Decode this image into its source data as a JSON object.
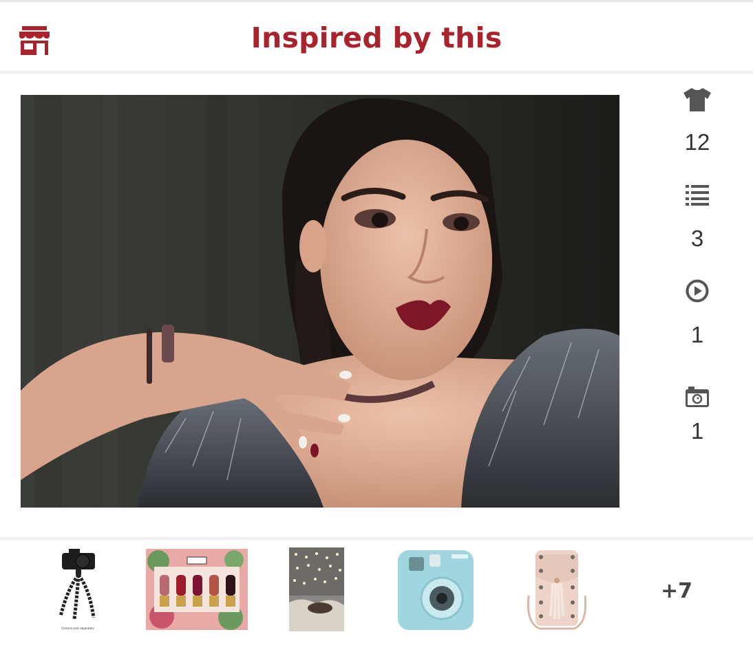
{
  "header": {
    "title": "Inspired by this",
    "store_icon": "store-icon"
  },
  "hero_image": {
    "description_icon": "portrait-photo"
  },
  "stats": [
    {
      "icon": "shirt-icon",
      "count": "12"
    },
    {
      "icon": "list-icon",
      "count": "3"
    },
    {
      "icon": "play-icon",
      "count": "1"
    },
    {
      "icon": "camera-icon",
      "count": "1"
    }
  ],
  "products": {
    "items": [
      {
        "icon": "tripod-camera",
        "caption": "Camera sold separately"
      },
      {
        "icon": "lipstick-set"
      },
      {
        "icon": "string-lights-photo"
      },
      {
        "icon": "instant-camera"
      },
      {
        "icon": "studded-bag"
      }
    ],
    "more_label": "+7"
  },
  "colors": {
    "accent": "#a8232b",
    "icon_gray": "#555555"
  }
}
